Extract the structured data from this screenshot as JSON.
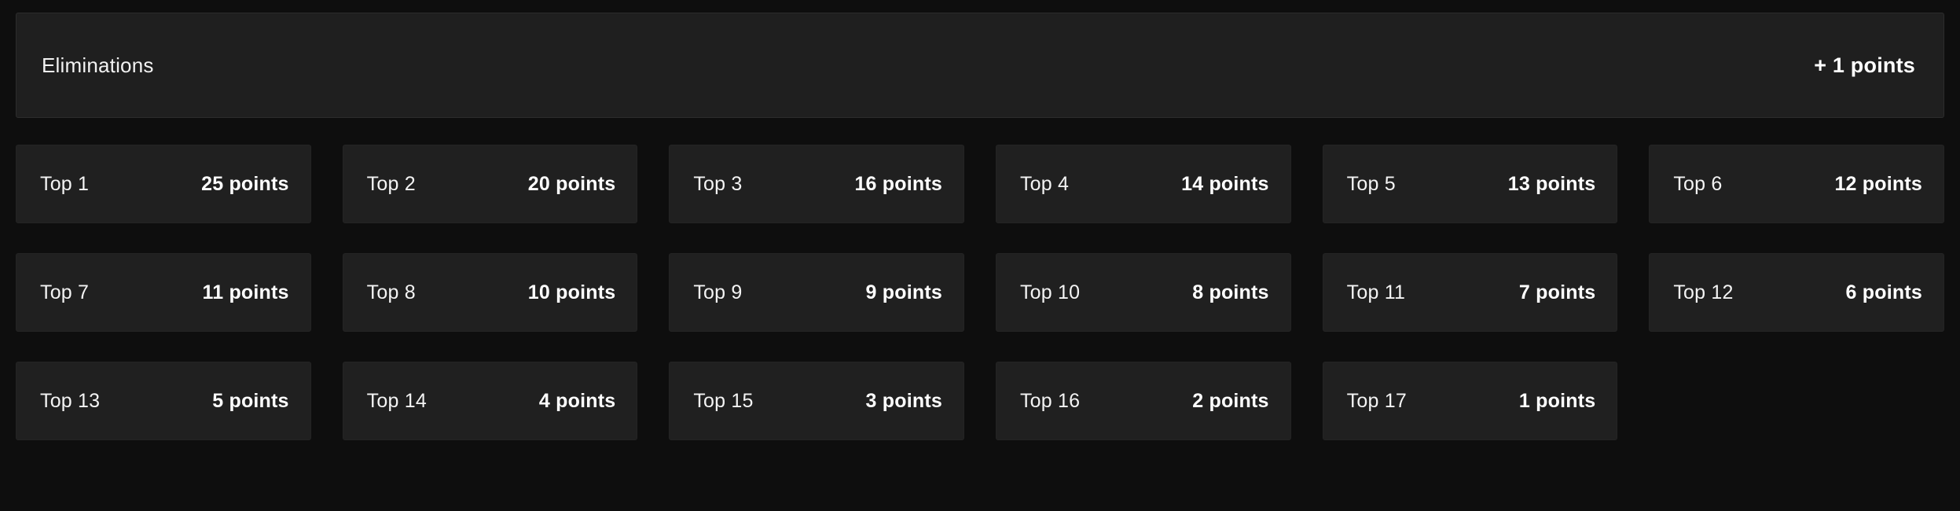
{
  "colors": {
    "page_background": "#0e0e0e",
    "card_background": "#202020",
    "header_card_background": "#1f1f1f",
    "card_border": "#242424",
    "text_primary": "#ffffff",
    "text_label": "#f4f4f4"
  },
  "header": {
    "title": "Eliminations",
    "points": "+ 1 points"
  },
  "tiers": [
    {
      "label": "Top 1",
      "points": "25 points",
      "value": 25
    },
    {
      "label": "Top 2",
      "points": "20 points",
      "value": 20
    },
    {
      "label": "Top 3",
      "points": "16 points",
      "value": 16
    },
    {
      "label": "Top 4",
      "points": "14 points",
      "value": 14
    },
    {
      "label": "Top 5",
      "points": "13 points",
      "value": 13
    },
    {
      "label": "Top 6",
      "points": "12 points",
      "value": 12
    },
    {
      "label": "Top 7",
      "points": "11 points",
      "value": 11
    },
    {
      "label": "Top 8",
      "points": "10 points",
      "value": 10
    },
    {
      "label": "Top 9",
      "points": "9 points",
      "value": 9
    },
    {
      "label": "Top 10",
      "points": "8 points",
      "value": 8
    },
    {
      "label": "Top 11",
      "points": "7 points",
      "value": 7
    },
    {
      "label": "Top 12",
      "points": "6 points",
      "value": 6
    },
    {
      "label": "Top 13",
      "points": "5 points",
      "value": 5
    },
    {
      "label": "Top 14",
      "points": "4 points",
      "value": 4
    },
    {
      "label": "Top 15",
      "points": "3 points",
      "value": 3
    },
    {
      "label": "Top 16",
      "points": "2 points",
      "value": 2
    },
    {
      "label": "Top 17",
      "points": "1 points",
      "value": 1
    }
  ]
}
